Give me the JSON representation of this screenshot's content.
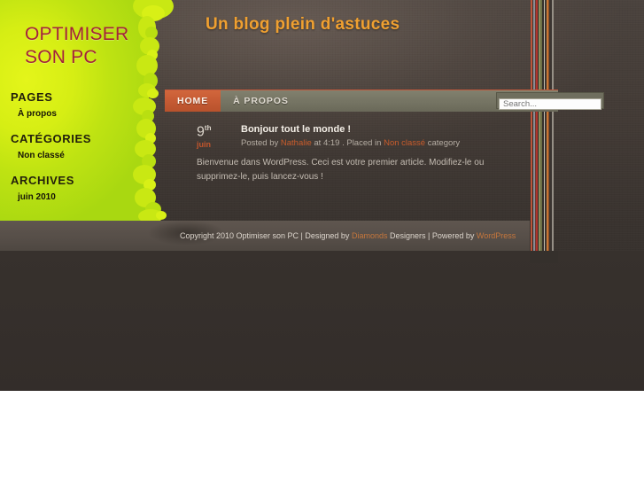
{
  "site": {
    "logo_line1": "OPTIMISER",
    "logo_line2": "SON PC",
    "tagline": "Un blog plein d'astuces"
  },
  "nav": {
    "items": [
      {
        "label": "HOME",
        "active": true
      },
      {
        "label": "À PROPOS",
        "active": false
      }
    ]
  },
  "search": {
    "placeholder": "Search...",
    "value": ""
  },
  "sidebar": {
    "sections": [
      {
        "title": "PAGES",
        "items": [
          {
            "label": "À propos"
          }
        ]
      },
      {
        "title": "CATÉGORIES",
        "items": [
          {
            "label": "Non classé"
          }
        ]
      },
      {
        "title": "ARCHIVES",
        "items": [
          {
            "label": "juin 2010"
          }
        ]
      }
    ]
  },
  "post": {
    "day": "9",
    "day_suffix": "th",
    "month": "juin",
    "title": "Bonjour tout le monde !",
    "meta_posted_by": "Posted by",
    "meta_author": "Nathalie",
    "meta_at": "at 4:19 . Placed in",
    "meta_category": "Non classé",
    "meta_category_suffix": "category",
    "body": "Bienvenue dans WordPress. Ceci est votre premier article. Modifiez-le ou supprimez-le, puis lancez-vous !"
  },
  "footer": {
    "copyright": "Copyright 2010 Optimiser son PC | Designed by",
    "designer_link": "Diamonds",
    "designer_suffix": "Designers | Powered by",
    "platform_link": "WordPress"
  },
  "colors": {
    "green": "#d6ee14",
    "logo_red": "#a4233a",
    "accent_orange": "#c45a33",
    "tagline_orange": "#f0a030",
    "dark_bg": "#35302c",
    "nav_bar": "#757463"
  }
}
